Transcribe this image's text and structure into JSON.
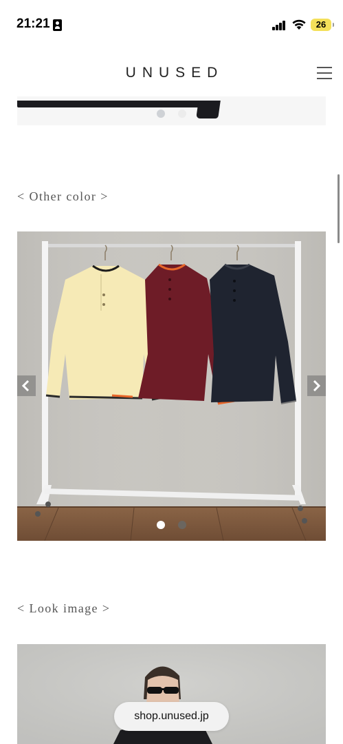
{
  "status_bar": {
    "time": "21:21",
    "battery": "26",
    "battery_color": "#f4e05a"
  },
  "header": {
    "logo": "UNUSED",
    "menu_icon": "hamburger-menu-icon"
  },
  "prev_carousel": {
    "pages": 2,
    "active_page": 1
  },
  "sections": {
    "other_color": "< Other color >",
    "look_image": "< Look image >"
  },
  "color_carousel": {
    "pages": 2,
    "active_page": 1,
    "prev_icon": "chevron-left-icon",
    "next_icon": "chevron-right-icon",
    "sweater_colors": [
      "#f6eab6",
      "#6e1c27",
      "#1f2430"
    ]
  },
  "browser": {
    "url": "shop.unused.jp"
  }
}
